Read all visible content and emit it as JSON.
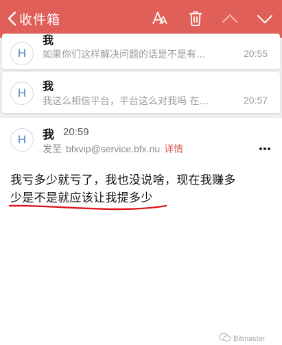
{
  "header": {
    "back_label": "收件箱",
    "icons": [
      "font-size-icon",
      "trash-icon",
      "chevron-up-icon",
      "chevron-down-icon"
    ],
    "background": "#e15f59"
  },
  "list": [
    {
      "avatar": "H",
      "sender": "我",
      "preview": "如果你们这样解决问题的话是不是有...",
      "time": "20:55"
    },
    {
      "avatar": "H",
      "sender": "我",
      "preview": "我这么相信平台，平台这么对我吗 在...",
      "time": "20:57"
    }
  ],
  "detail": {
    "avatar": "H",
    "sender": "我",
    "time": "20:59",
    "to_prefix": "发至",
    "to_address": "bfxvip@service.bfx.nu",
    "details_link": "详情",
    "body_line1": "我亏多少就亏了，我也没说啥，现在我赚多",
    "body_line2": "少是不是就应该让我提多少",
    "underline_color": "#e0151b"
  },
  "watermark": "Bitmaster"
}
